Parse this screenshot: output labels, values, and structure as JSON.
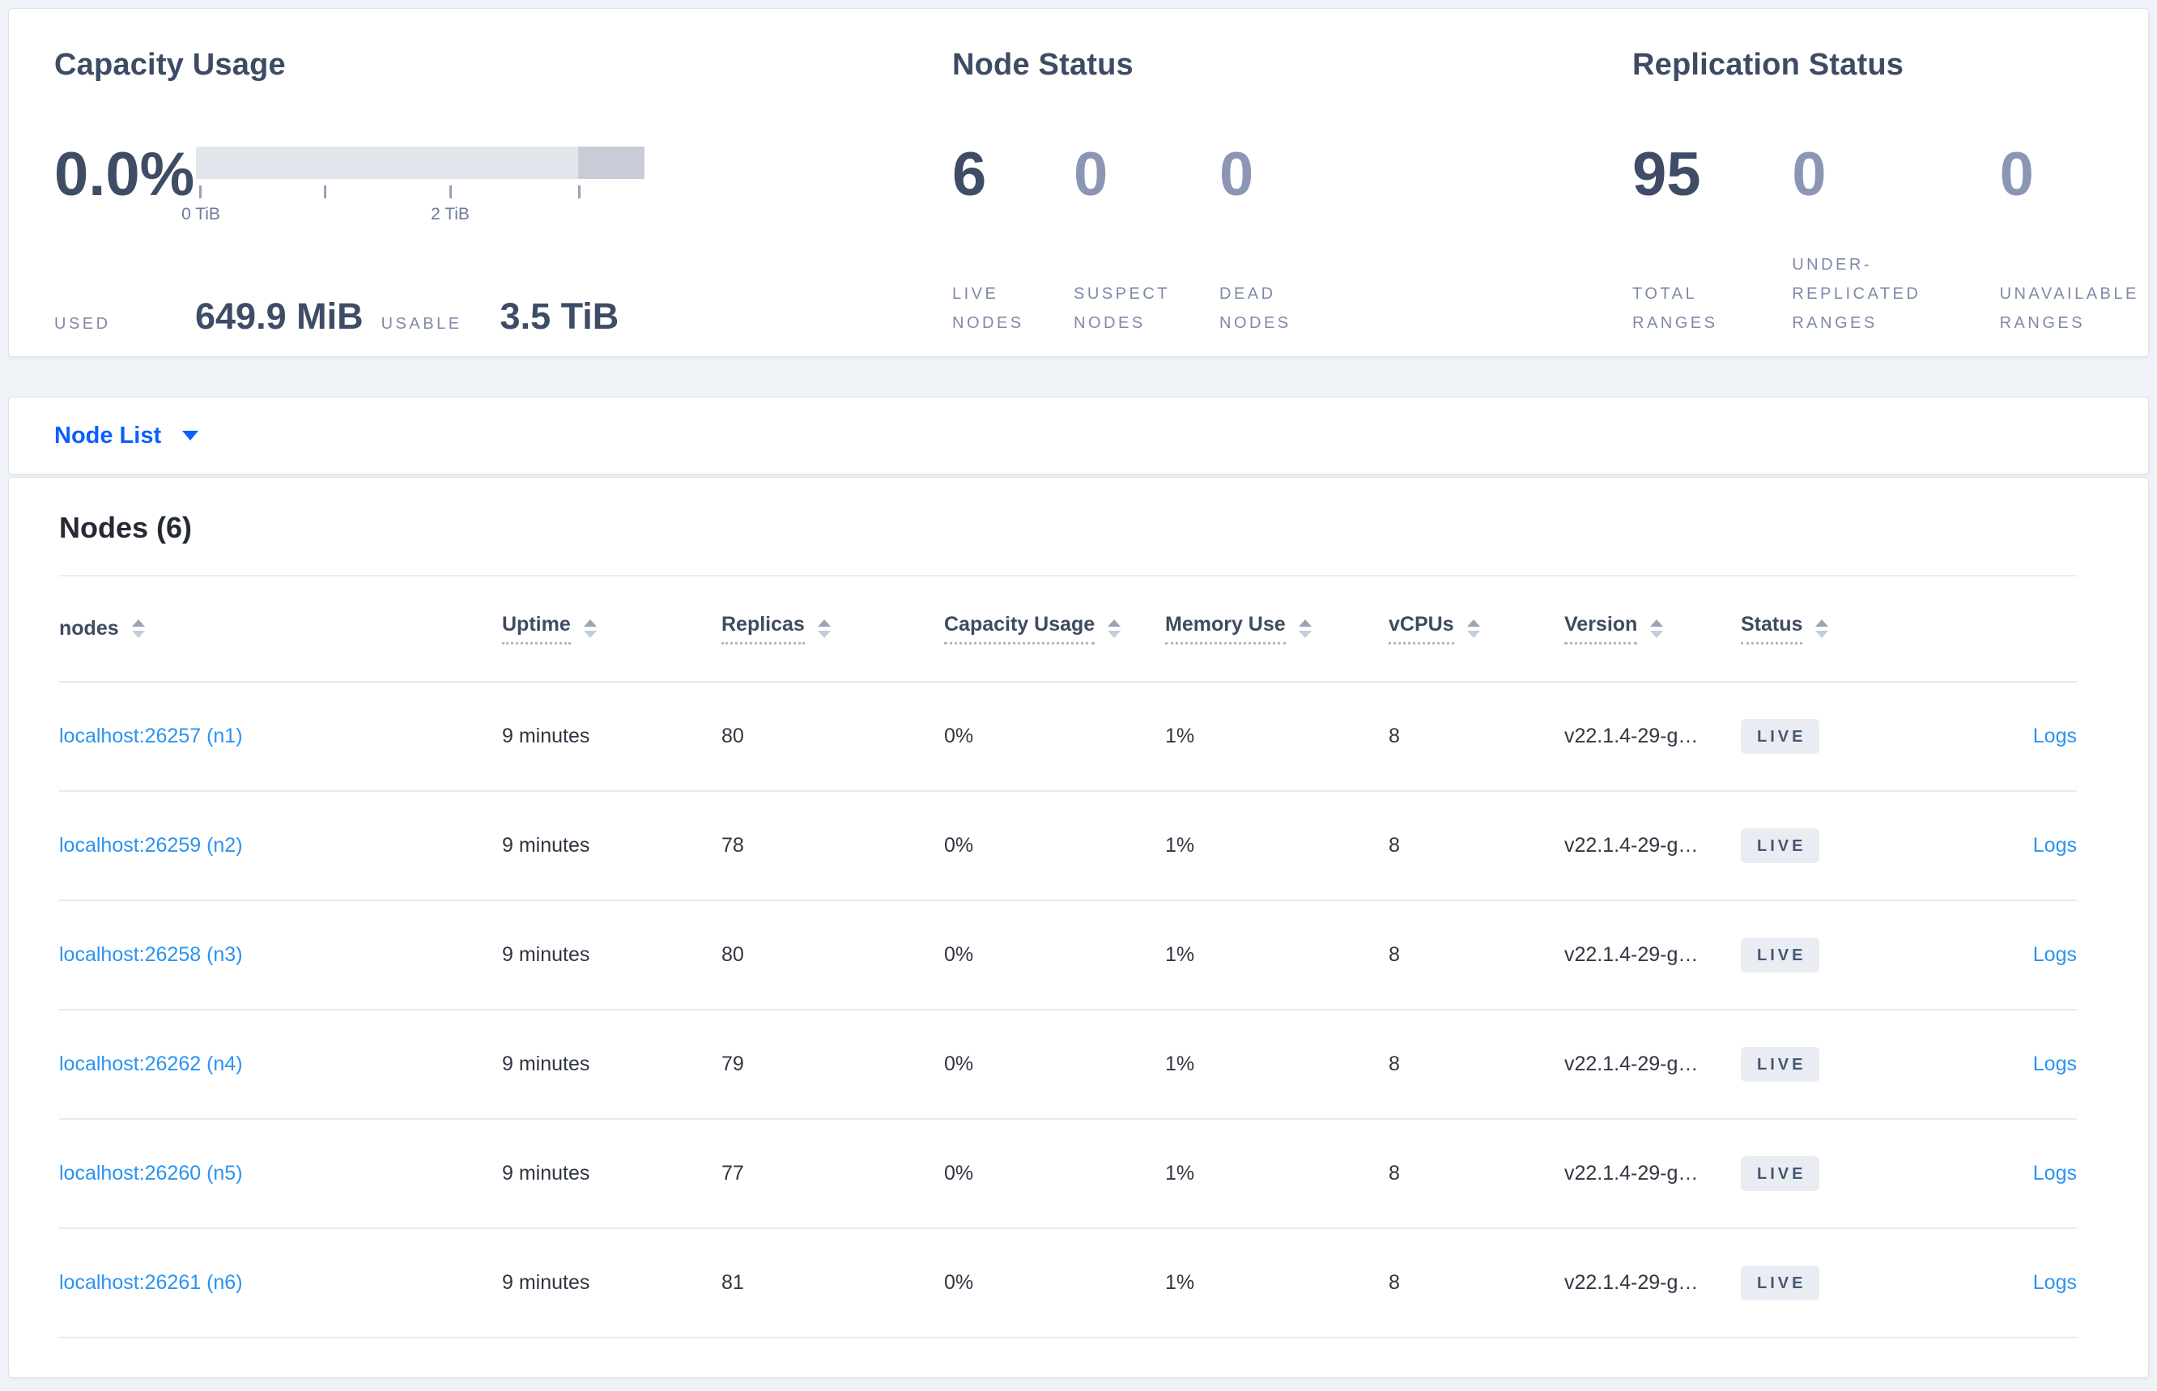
{
  "colors": {
    "accent_blue": "#0b5fff",
    "link_blue": "#2a93f0",
    "heading_slate": "#3d4b64",
    "muted_number": "#8c96b4",
    "label_gray": "#7f8aa8",
    "badge_bg": "#e9edf3",
    "badge_text": "#45566f",
    "gauge_bar_light": "#e2e5eb",
    "gauge_bar_dark": "#c9ccd6"
  },
  "capacity": {
    "title": "Capacity Usage",
    "percent": "0.0%",
    "ticks": [
      "0 TiB",
      "2 TiB"
    ],
    "used_label": "USED",
    "used_value": "649.9 MiB",
    "usable_label": "USABLE",
    "usable_value": "3.5 TiB"
  },
  "node_status": {
    "title": "Node Status",
    "stats": [
      {
        "value": "6",
        "label": "LIVE NODES",
        "emphasis": true
      },
      {
        "value": "0",
        "label": "SUSPECT NODES",
        "emphasis": false
      },
      {
        "value": "0",
        "label": "DEAD NODES",
        "emphasis": false
      }
    ]
  },
  "replication_status": {
    "title": "Replication Status",
    "stats": [
      {
        "value": "95",
        "label": "TOTAL RANGES",
        "emphasis": true
      },
      {
        "value": "0",
        "label": "UNDER-REPLICATED RANGES",
        "emphasis": false
      },
      {
        "value": "0",
        "label": "UNAVAILABLE RANGES",
        "emphasis": false
      }
    ]
  },
  "view_selector": {
    "label": "Node List"
  },
  "nodes_table": {
    "title": "Nodes (6)",
    "columns": [
      {
        "label": "nodes",
        "underline": false
      },
      {
        "label": "Uptime",
        "underline": true
      },
      {
        "label": "Replicas",
        "underline": true
      },
      {
        "label": "Capacity Usage",
        "underline": true
      },
      {
        "label": "Memory Use",
        "underline": true
      },
      {
        "label": "vCPUs",
        "underline": true
      },
      {
        "label": "Version",
        "underline": true
      },
      {
        "label": "Status",
        "underline": true
      }
    ],
    "rows": [
      {
        "node": "localhost:26257 (n1)",
        "uptime": "9 minutes",
        "replicas": "80",
        "capacity_usage": "0%",
        "memory_use": "1%",
        "vcpus": "8",
        "version": "v22.1.4-29-g…",
        "status": "LIVE",
        "logs": "Logs"
      },
      {
        "node": "localhost:26259 (n2)",
        "uptime": "9 minutes",
        "replicas": "78",
        "capacity_usage": "0%",
        "memory_use": "1%",
        "vcpus": "8",
        "version": "v22.1.4-29-g…",
        "status": "LIVE",
        "logs": "Logs"
      },
      {
        "node": "localhost:26258 (n3)",
        "uptime": "9 minutes",
        "replicas": "80",
        "capacity_usage": "0%",
        "memory_use": "1%",
        "vcpus": "8",
        "version": "v22.1.4-29-g…",
        "status": "LIVE",
        "logs": "Logs"
      },
      {
        "node": "localhost:26262 (n4)",
        "uptime": "9 minutes",
        "replicas": "79",
        "capacity_usage": "0%",
        "memory_use": "1%",
        "vcpus": "8",
        "version": "v22.1.4-29-g…",
        "status": "LIVE",
        "logs": "Logs"
      },
      {
        "node": "localhost:26260 (n5)",
        "uptime": "9 minutes",
        "replicas": "77",
        "capacity_usage": "0%",
        "memory_use": "1%",
        "vcpus": "8",
        "version": "v22.1.4-29-g…",
        "status": "LIVE",
        "logs": "Logs"
      },
      {
        "node": "localhost:26261 (n6)",
        "uptime": "9 minutes",
        "replicas": "81",
        "capacity_usage": "0%",
        "memory_use": "1%",
        "vcpus": "8",
        "version": "v22.1.4-29-g…",
        "status": "LIVE",
        "logs": "Logs"
      }
    ]
  }
}
